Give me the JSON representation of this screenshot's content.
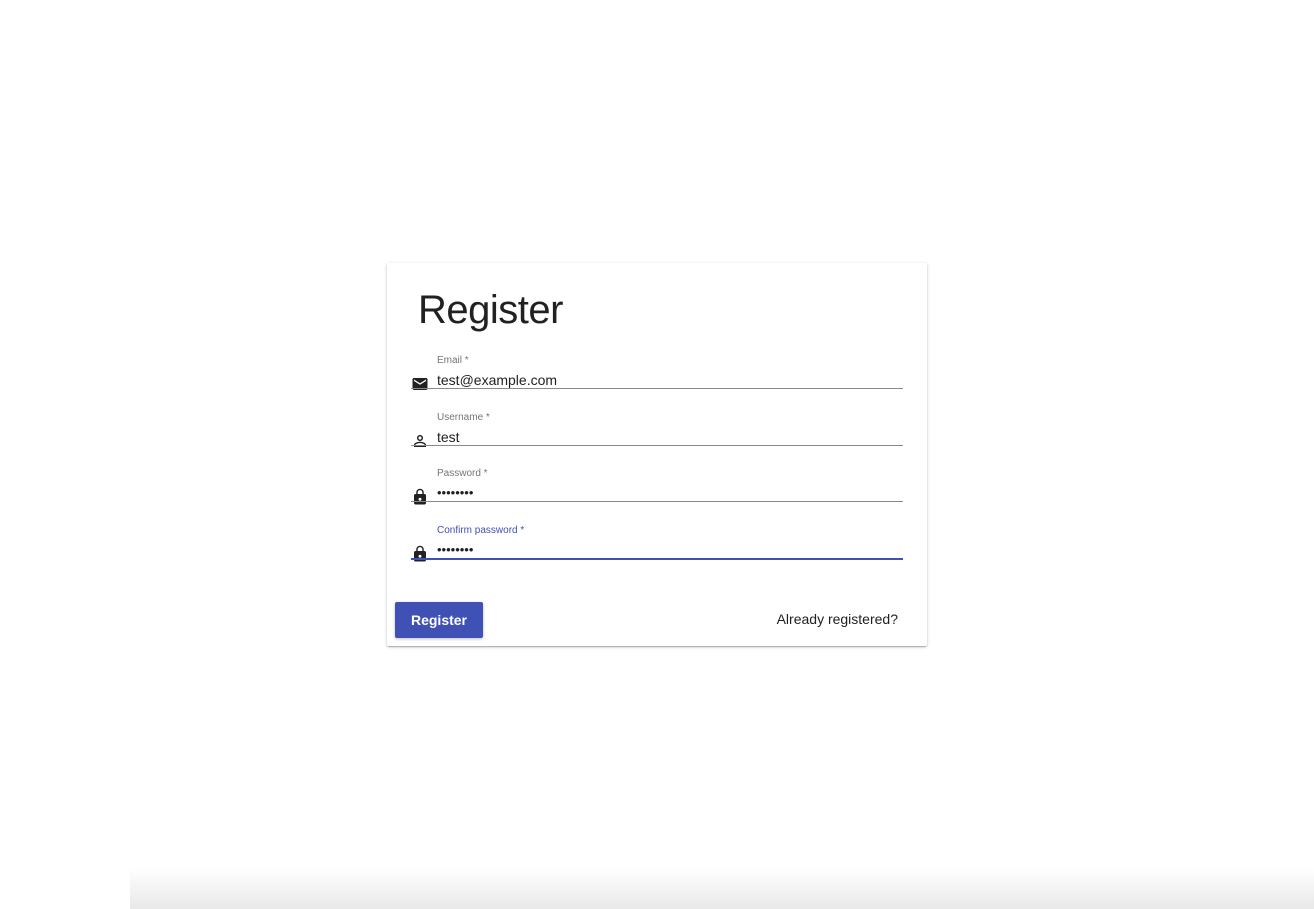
{
  "form": {
    "title": "Register",
    "fields": [
      {
        "label": "Email *",
        "value": "test@example.com",
        "icon": "mail-icon"
      },
      {
        "label": "Username *",
        "value": "test",
        "icon": "person-icon"
      },
      {
        "label": "Password *",
        "value": "••••••••",
        "icon": "lock-icon"
      },
      {
        "label": "Confirm password *",
        "value": "••••••••",
        "icon": "lock-icon",
        "focused": true
      }
    ],
    "submit_label": "Register",
    "login_link": "Already registered?"
  },
  "colors": {
    "accent": "#3f51b5",
    "text": "#212121",
    "label": "#757575"
  }
}
